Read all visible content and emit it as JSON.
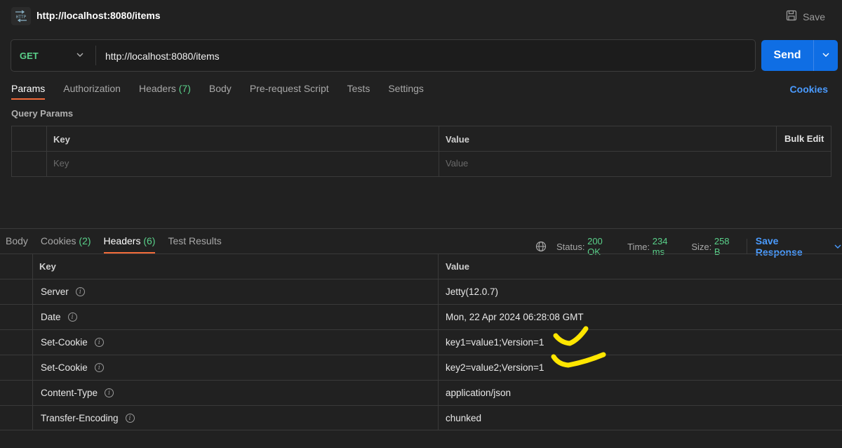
{
  "topbar": {
    "icon_label": "HTTP",
    "title": "http://localhost:8080/items",
    "save_label": "Save"
  },
  "request": {
    "method": "GET",
    "url": "http://localhost:8080/items",
    "send_label": "Send"
  },
  "request_tabs": [
    {
      "label": "Params",
      "count": "",
      "active": true
    },
    {
      "label": "Authorization",
      "count": "",
      "active": false
    },
    {
      "label": "Headers",
      "count": "(7)",
      "active": false
    },
    {
      "label": "Body",
      "count": "",
      "active": false
    },
    {
      "label": "Pre-request Script",
      "count": "",
      "active": false
    },
    {
      "label": "Tests",
      "count": "",
      "active": false
    },
    {
      "label": "Settings",
      "count": "",
      "active": false
    }
  ],
  "cookies_link": "Cookies",
  "query_params": {
    "title": "Query Params",
    "col_key": "Key",
    "col_value": "Value",
    "bulk_edit": "Bulk Edit",
    "key_placeholder": "Key",
    "value_placeholder": "Value"
  },
  "response_tabs": [
    {
      "label": "Body",
      "count": "",
      "active": false
    },
    {
      "label": "Cookies",
      "count": "(2)",
      "active": false
    },
    {
      "label": "Headers",
      "count": "(6)",
      "active": true
    },
    {
      "label": "Test Results",
      "count": "",
      "active": false
    }
  ],
  "response_status": {
    "status_label": "Status:",
    "status_value": "200 OK",
    "time_label": "Time:",
    "time_value": "234 ms",
    "size_label": "Size:",
    "size_value": "258 B",
    "save_response": "Save Response"
  },
  "response_headers": {
    "col_key": "Key",
    "col_value": "Value",
    "rows": [
      {
        "key": "Server",
        "value": "Jetty(12.0.7)"
      },
      {
        "key": "Date",
        "value": "Mon, 22 Apr 2024 06:28:08 GMT"
      },
      {
        "key": "Set-Cookie",
        "value": "key1=value1;Version=1"
      },
      {
        "key": "Set-Cookie",
        "value": "key2=value2;Version=1"
      },
      {
        "key": "Content-Type",
        "value": "application/json"
      },
      {
        "key": "Transfer-Encoding",
        "value": "chunked"
      }
    ]
  },
  "colors": {
    "background": "#212121",
    "accent_blue": "#0f6ee4",
    "method_green": "#5ad18a",
    "tab_underline": "#f26b3a",
    "annotation_yellow": "#ffe600"
  },
  "icons": [
    "http-icon",
    "save-icon",
    "chevron-down-icon",
    "globe-icon",
    "info-icon"
  ]
}
